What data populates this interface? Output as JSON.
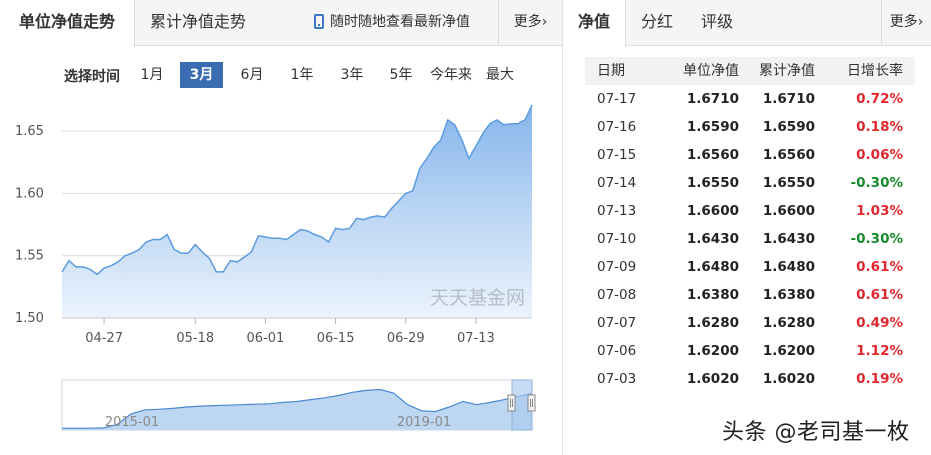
{
  "left_tabs": {
    "unit_nav": "单位净值走势",
    "acc_nav": "累计净值走势",
    "mobile": "随时随地查看最新净值",
    "more": "更多"
  },
  "range": {
    "label": "选择时间",
    "options": [
      "1月",
      "3月",
      "6月",
      "1年",
      "3年",
      "5年",
      "今年来",
      "最大"
    ],
    "selected": "3月"
  },
  "watermark": "天天基金网",
  "chart_data": {
    "type": "area",
    "ylim": [
      1.5,
      1.675
    ],
    "yticks": [
      1.5,
      1.55,
      1.6,
      1.65
    ],
    "ytick_labels": [
      "1.50",
      "1.55",
      "1.60",
      "1.65"
    ],
    "xtick_labels": [
      "04-27",
      "05-18",
      "06-01",
      "06-15",
      "06-29",
      "07-13"
    ],
    "xtick_index": [
      6,
      19,
      29,
      39,
      49,
      59
    ],
    "values": [
      1.537,
      1.546,
      1.541,
      1.541,
      1.539,
      1.535,
      1.54,
      1.542,
      1.545,
      1.55,
      1.552,
      1.555,
      1.561,
      1.563,
      1.563,
      1.567,
      1.555,
      1.552,
      1.552,
      1.559,
      1.553,
      1.548,
      1.537,
      1.537,
      1.546,
      1.545,
      1.549,
      1.553,
      1.566,
      1.565,
      1.564,
      1.564,
      1.563,
      1.567,
      1.571,
      1.57,
      1.567,
      1.565,
      1.561,
      1.572,
      1.571,
      1.572,
      1.58,
      1.579,
      1.581,
      1.582,
      1.581,
      1.588,
      1.594,
      1.6,
      1.602,
      1.62,
      1.628,
      1.637,
      1.643,
      1.659,
      1.655,
      1.643,
      1.628,
      1.638,
      1.648,
      1.656,
      1.659,
      1.655,
      1.656,
      1.656,
      1.659,
      1.671
    ],
    "navigator": {
      "xtick_labels": [
        "2015-01",
        "2019-01"
      ],
      "values": [
        0.04,
        0.04,
        0.04,
        0.045,
        0.12,
        0.35,
        0.44,
        0.45,
        0.47,
        0.5,
        0.52,
        0.53,
        0.54,
        0.55,
        0.56,
        0.57,
        0.6,
        0.62,
        0.66,
        0.7,
        0.75,
        0.82,
        0.86,
        0.88,
        0.8,
        0.55,
        0.42,
        0.4,
        0.5,
        0.62,
        0.55,
        0.6,
        0.66,
        0.73,
        0.8
      ]
    }
  },
  "right_tabs": {
    "nav": "净值",
    "dividend": "分红",
    "rating": "评级",
    "more": "更多"
  },
  "table": {
    "headers": [
      "日期",
      "单位净值",
      "累计净值",
      "日增长率"
    ],
    "rows": [
      {
        "date": "07-17",
        "unit": "1.6710",
        "acc": "1.6710",
        "rate": "0.72%",
        "dir": "up"
      },
      {
        "date": "07-16",
        "unit": "1.6590",
        "acc": "1.6590",
        "rate": "0.18%",
        "dir": "up"
      },
      {
        "date": "07-15",
        "unit": "1.6560",
        "acc": "1.6560",
        "rate": "0.06%",
        "dir": "up"
      },
      {
        "date": "07-14",
        "unit": "1.6550",
        "acc": "1.6550",
        "rate": "-0.30%",
        "dir": "down"
      },
      {
        "date": "07-13",
        "unit": "1.6600",
        "acc": "1.6600",
        "rate": "1.03%",
        "dir": "up"
      },
      {
        "date": "07-10",
        "unit": "1.6430",
        "acc": "1.6430",
        "rate": "-0.30%",
        "dir": "down"
      },
      {
        "date": "07-09",
        "unit": "1.6480",
        "acc": "1.6480",
        "rate": "0.61%",
        "dir": "up"
      },
      {
        "date": "07-08",
        "unit": "1.6380",
        "acc": "1.6380",
        "rate": "0.61%",
        "dir": "up"
      },
      {
        "date": "07-07",
        "unit": "1.6280",
        "acc": "1.6280",
        "rate": "0.49%",
        "dir": "up"
      },
      {
        "date": "07-06",
        "unit": "1.6200",
        "acc": "1.6200",
        "rate": "1.12%",
        "dir": "up"
      },
      {
        "date": "07-03",
        "unit": "1.6020",
        "acc": "1.6020",
        "rate": "0.19%",
        "dir": "up"
      }
    ]
  },
  "footer_text": "头条 @老司基一枚",
  "colors": {
    "accent": "#3b6db3",
    "up": "#e0272d",
    "down": "#1a8b2c",
    "area": "#7fb1ea"
  }
}
